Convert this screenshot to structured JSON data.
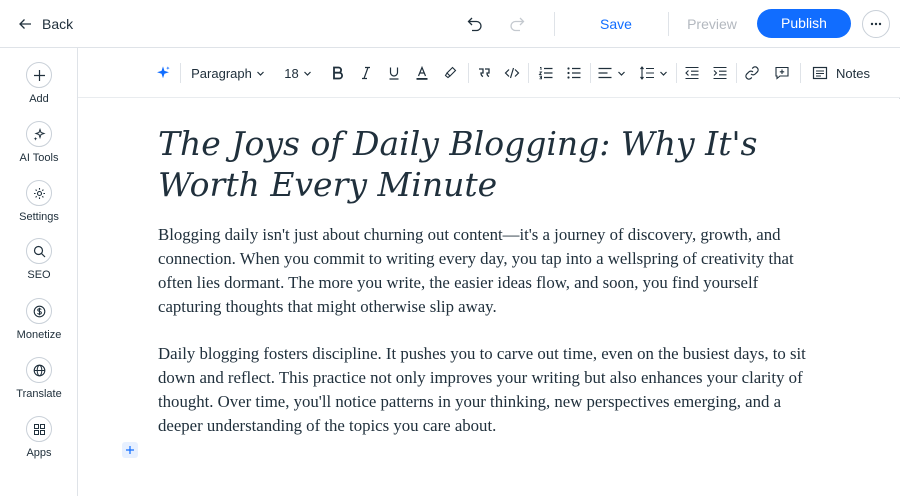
{
  "header": {
    "back_label": "Back",
    "save_label": "Save",
    "preview_label": "Preview",
    "publish_label": "Publish",
    "more_icon": "ellipsis-icon"
  },
  "sidebar": {
    "items": [
      {
        "label": "Add",
        "icon": "plus-icon"
      },
      {
        "label": "AI Tools",
        "icon": "sparkle-icon"
      },
      {
        "label": "Settings",
        "icon": "gear-icon"
      },
      {
        "label": "SEO",
        "icon": "search-icon"
      },
      {
        "label": "Monetize",
        "icon": "dollar-icon"
      },
      {
        "label": "Translate",
        "icon": "globe-icon"
      },
      {
        "label": "Apps",
        "icon": "apps-icon"
      }
    ]
  },
  "toolbar": {
    "block_style": "Paragraph",
    "font_size": "18",
    "notes_label": "Notes"
  },
  "post": {
    "title": "The Joys of Daily Blogging: Why It's Worth Every Minute",
    "paragraphs": [
      "Blogging daily isn't just about churning out content—it's a journey of discovery, growth, and connection. When you commit to writing every day, you tap into a wellspring of creativity that often lies dormant. The more you write, the easier ideas flow, and soon, you find yourself capturing thoughts that might otherwise slip away.",
      "Daily blogging fosters discipline. It pushes you to carve out time, even on the busiest days, to sit down and reflect. This practice not only improves your writing but also enhances your clarity of thought. Over time, you'll notice patterns in your thinking, new perspectives emerging, and a deeper understanding of the topics you care about."
    ]
  },
  "colors": {
    "accent": "#116dff",
    "text": "#20303c",
    "disabled": "#b3b8bf",
    "border": "#dfe3e8"
  }
}
